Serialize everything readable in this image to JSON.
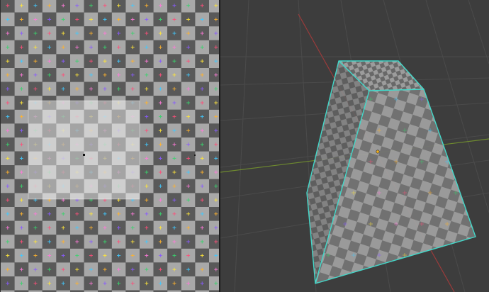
{
  "uv_editor": {
    "grid_tiles": 16,
    "colors": {
      "dark_tile": "#595959",
      "light_tile": "#a8a8a8",
      "selected_dark": "#c8c8c8",
      "selected_light": "#e2e2e2",
      "marker_colors": [
        "#ff4f7a",
        "#ffb32e",
        "#39d46d",
        "#42c9ff",
        "#8a5cff",
        "#ffe63a",
        "#ff7ad9"
      ]
    },
    "cursor_icon": "uv-2d-cursor-icon"
  },
  "viewport_3d": {
    "colors": {
      "background": "#3d3d3d",
      "grid_line": "#4a4a4a",
      "x_axis": "#9b3b3b",
      "y_axis": "#6f8b2f",
      "selection_edge": "#43d8c9",
      "mesh_fill_dark": "#6a6a6a",
      "mesh_fill_light": "#9a9a9a"
    },
    "origin_icon": "object-origin-icon"
  }
}
